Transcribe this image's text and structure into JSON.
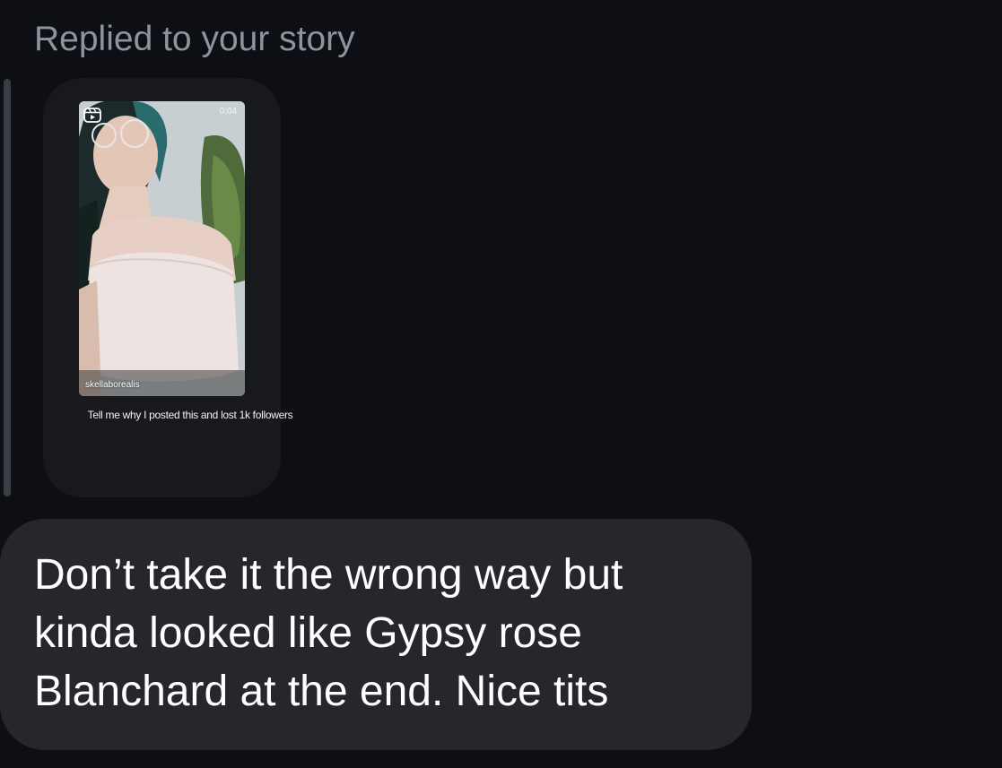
{
  "reply_header": "Replied to your story",
  "story": {
    "duration": "0:04",
    "username": "skellaborealis",
    "caption": "Tell me why I posted this and lost 1k followers",
    "icons": {
      "reel": "reels-icon"
    }
  },
  "message": {
    "text": "Don’t take it the wrong way but kinda looked like Gypsy rose Blanchard at the end. Nice tits"
  },
  "colors": {
    "background": "#0d0f14",
    "bubble": "#25272c",
    "card": "#17191d",
    "header_text": "#8f939b"
  }
}
